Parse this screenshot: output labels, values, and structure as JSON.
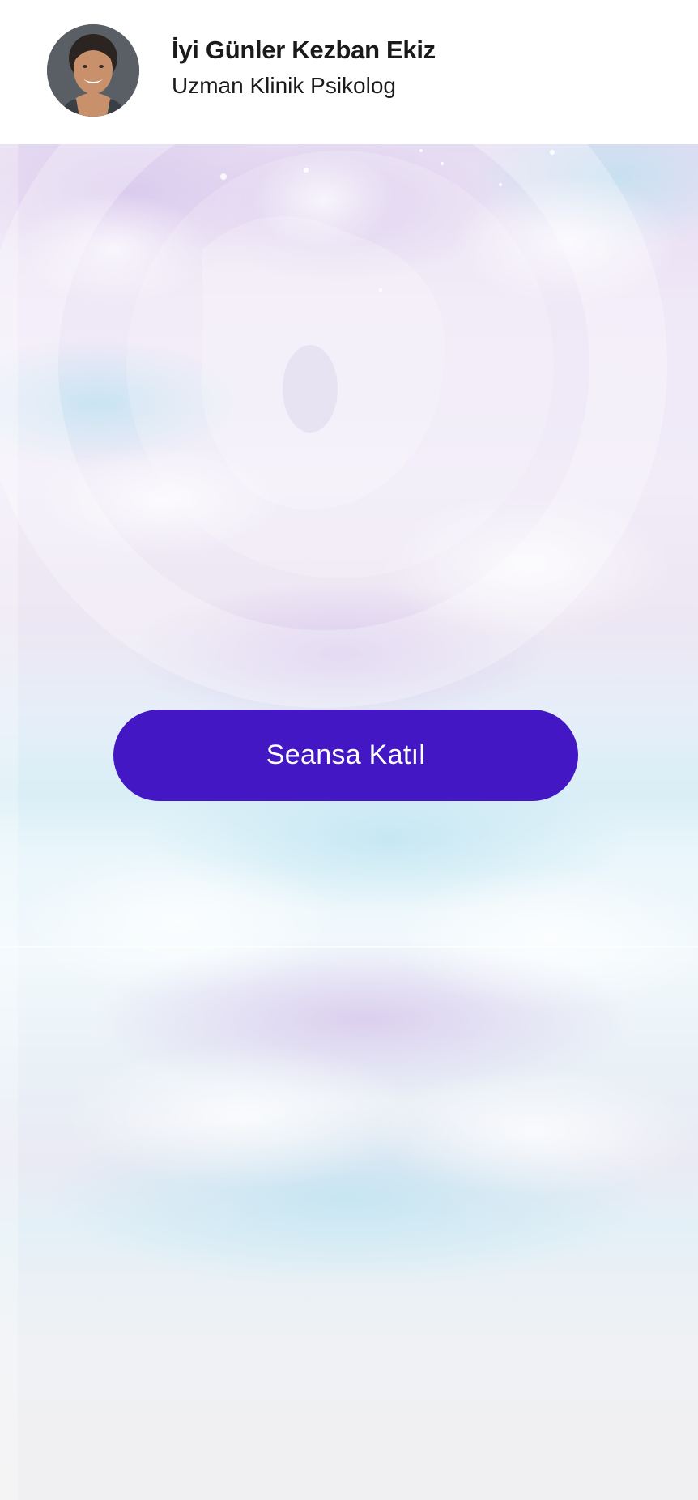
{
  "header": {
    "greeting": "İyi Günler Kezban Ekiz",
    "title": "Uzman Klinik Psikolog",
    "avatar_icon": "user-photo"
  },
  "main": {
    "join_button_label": "Seansa Katıl"
  },
  "colors": {
    "primary_button": "#4318c4",
    "header_bg": "#ffffff",
    "text": "#1a1a1a"
  }
}
